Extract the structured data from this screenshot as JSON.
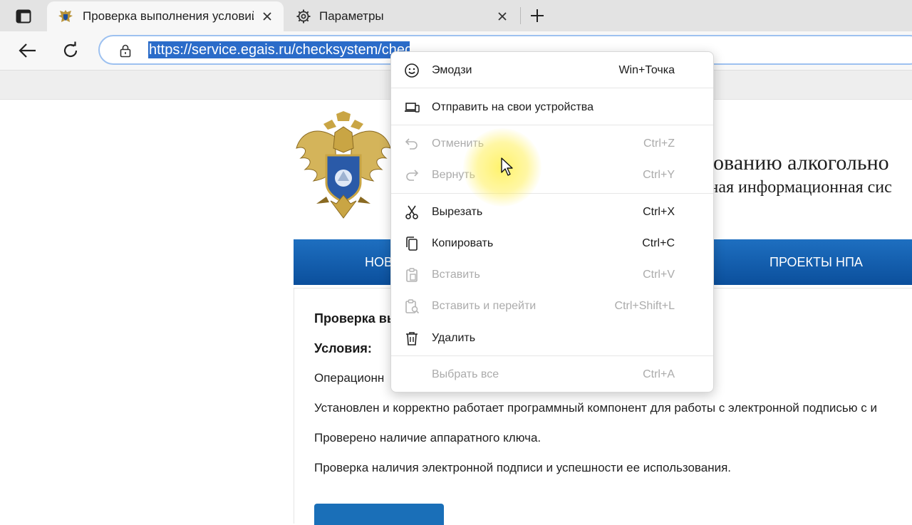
{
  "browser": {
    "tabs": [
      {
        "title": "Проверка выполнения условий",
        "active": true,
        "icon": "eagle-emblem-favicon"
      },
      {
        "title": "Параметры",
        "active": false,
        "icon": "gear-icon"
      }
    ],
    "address_bar": {
      "url": "https://service.egais.ru/checksystem/check"
    }
  },
  "page": {
    "header_line1": "ированию алкогольно",
    "header_line2": "анная информационная сис",
    "nav": [
      {
        "label": "НОВ"
      },
      {
        "label": "ПРОЕКТЫ НПА"
      }
    ],
    "heading": "Проверка вы",
    "conditions_label": "Условия:",
    "lines": [
      "Операционн",
      "Установлен и корректно работает программный компонент для работы с электронной подписью с и",
      "Проверено наличие аппаратного ключа.",
      "Проверка наличия электронной подписи и успешности ее использования."
    ]
  },
  "context_menu": {
    "items": [
      {
        "label": "Эмодзи",
        "shortcut": "Win+Точка",
        "icon": "emoji-icon",
        "enabled": true
      },
      {
        "label": "Отправить на свои устройства",
        "shortcut": "",
        "icon": "send-to-devices-icon",
        "enabled": true
      },
      {
        "label": "Отменить",
        "shortcut": "Ctrl+Z",
        "icon": "undo-icon",
        "enabled": false
      },
      {
        "label": "Вернуть",
        "shortcut": "Ctrl+Y",
        "icon": "redo-icon",
        "enabled": false
      },
      {
        "label": "Вырезать",
        "shortcut": "Ctrl+X",
        "icon": "scissors-icon",
        "enabled": true
      },
      {
        "label": "Копировать",
        "shortcut": "Ctrl+C",
        "icon": "copy-icon",
        "enabled": true
      },
      {
        "label": "Вставить",
        "shortcut": "Ctrl+V",
        "icon": "paste-icon",
        "enabled": false
      },
      {
        "label": "Вставить и перейти",
        "shortcut": "Ctrl+Shift+L",
        "icon": "paste-and-go-icon",
        "enabled": false
      },
      {
        "label": "Удалить",
        "shortcut": "",
        "icon": "trash-icon",
        "enabled": true
      },
      {
        "label": "Выбрать все",
        "shortcut": "Ctrl+A",
        "icon": "",
        "enabled": false
      }
    ]
  },
  "colors": {
    "accent": "#2b6cc9",
    "nav_band": "#0f5aa8",
    "disabled_text": "#ababab"
  }
}
